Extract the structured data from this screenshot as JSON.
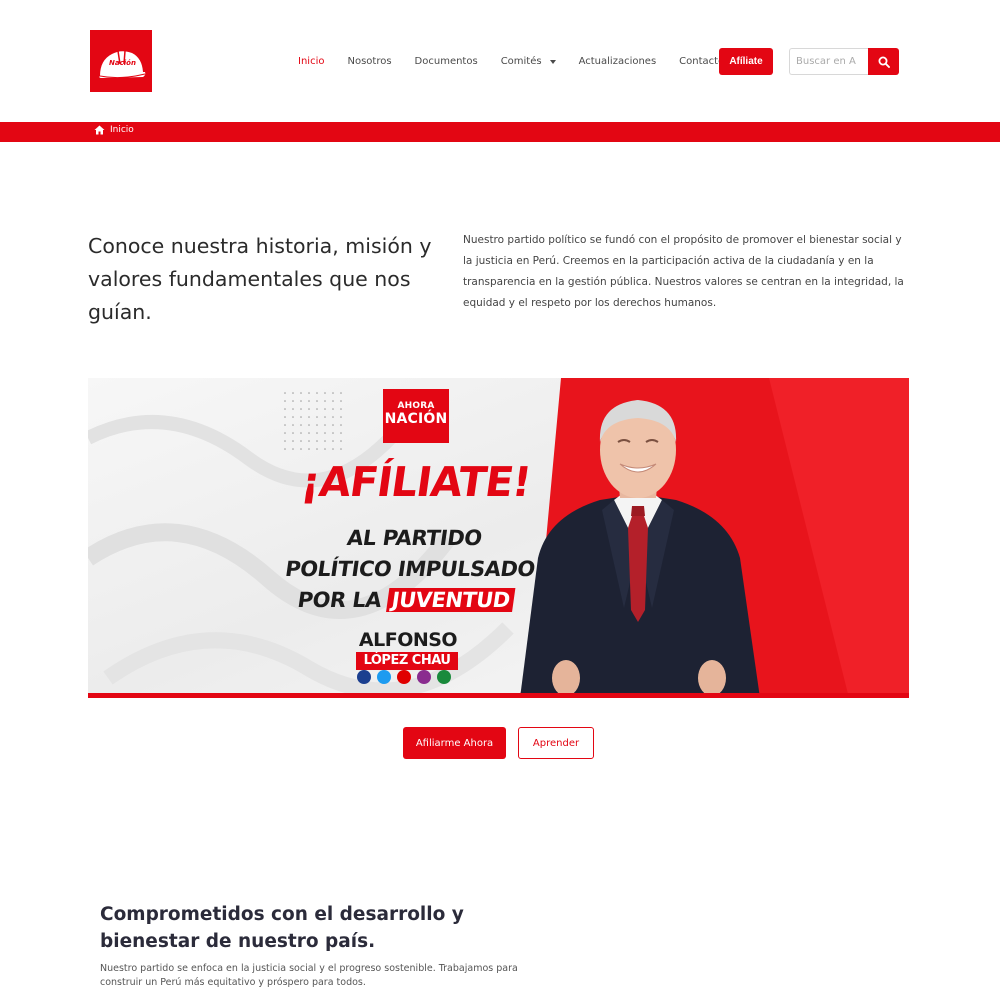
{
  "brand": {
    "logo_alt": "Nación",
    "accent_color": "#e30613"
  },
  "nav": {
    "items": [
      {
        "label": "Inicio"
      },
      {
        "label": "Nosotros"
      },
      {
        "label": "Documentos"
      },
      {
        "label": "Comités"
      },
      {
        "label": "Actualizaciones"
      },
      {
        "label": "Contacto"
      }
    ],
    "affiliate_label": "Afíliate",
    "search_placeholder": "Buscar en A"
  },
  "breadcrumb": {
    "home_icon": "home-icon",
    "label": "Inicio"
  },
  "intro": {
    "title": "Conoce nuestra historia, misión y valores fundamentales que nos guían.",
    "text": "Nuestro partido político se fundó con el propósito de promover el bienestar social y la justicia en Perú. Creemos en la participación activa de la ciudadanía y en la transparencia en la gestión pública. Nuestros valores se centran en la integridad, la equidad y el respeto por los derechos humanos."
  },
  "banner": {
    "logo_line1": "AHORA",
    "logo_line2": "NACIÓN",
    "headline": "¡AFÍLIATE!",
    "sub_line1": "AL PARTIDO",
    "sub_line2": "POLÍTICO IMPULSADO",
    "sub_line3": "POR LA",
    "sub_highlight": "JUVENTUD",
    "name_first": "ALFONSO",
    "name_last": "LÓPEZ CHAU",
    "socials": [
      "facebook-icon",
      "twitter-icon",
      "youtube-icon",
      "instagram-icon",
      "whatsapp-icon"
    ]
  },
  "cta": {
    "primary_label": "Afiliarme Ahora",
    "secondary_label": "Aprender"
  },
  "commitment": {
    "title": "Comprometidos con el desarrollo y bienestar de nuestro país.",
    "text": "Nuestro partido se enfoca en la justicia social y el progreso sostenible. Trabajamos para construir un Perú más equitativo y próspero para todos."
  }
}
